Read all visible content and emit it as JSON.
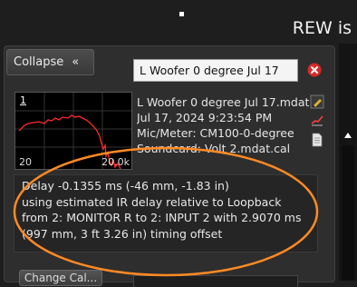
{
  "app": {
    "title_fragment": "REW is"
  },
  "panel": {
    "collapse_label": "Collapse",
    "collapse_chevron": "«",
    "measurement_name": "L Woofer 0 degree Jul 17"
  },
  "graph": {
    "index": "1",
    "freq_low": "20",
    "freq_high": "20.0k",
    "trace_color": "#ff2a2a"
  },
  "info": {
    "lines": [
      "L Woofer 0 degree Jul 17.mdat",
      "Jul 17, 2024 9:23:54 PM",
      "Mic/Meter: CM100-0-degree",
      "Soundcard: Volt 2.mdat.cal"
    ]
  },
  "delay": {
    "lines": [
      "Delay -0.1355 ms (-46 mm, -1.83 in)",
      "using estimated IR delay relative to Loopback",
      "from 2: MONITOR R to 2: INPUT 2 with 2.9070 ms",
      "(997 mm, 3 ft 3.26 in) timing offset"
    ]
  },
  "footer": {
    "change_cal_label": "Change Cal..."
  },
  "icons": {
    "close": "close-icon",
    "edit": "pencil-edit-icon",
    "graph": "line-graph-icon",
    "notes": "document-icon"
  },
  "colors": {
    "highlight_ellipse": "#ff8a24",
    "close_red": "#d42b2b"
  }
}
